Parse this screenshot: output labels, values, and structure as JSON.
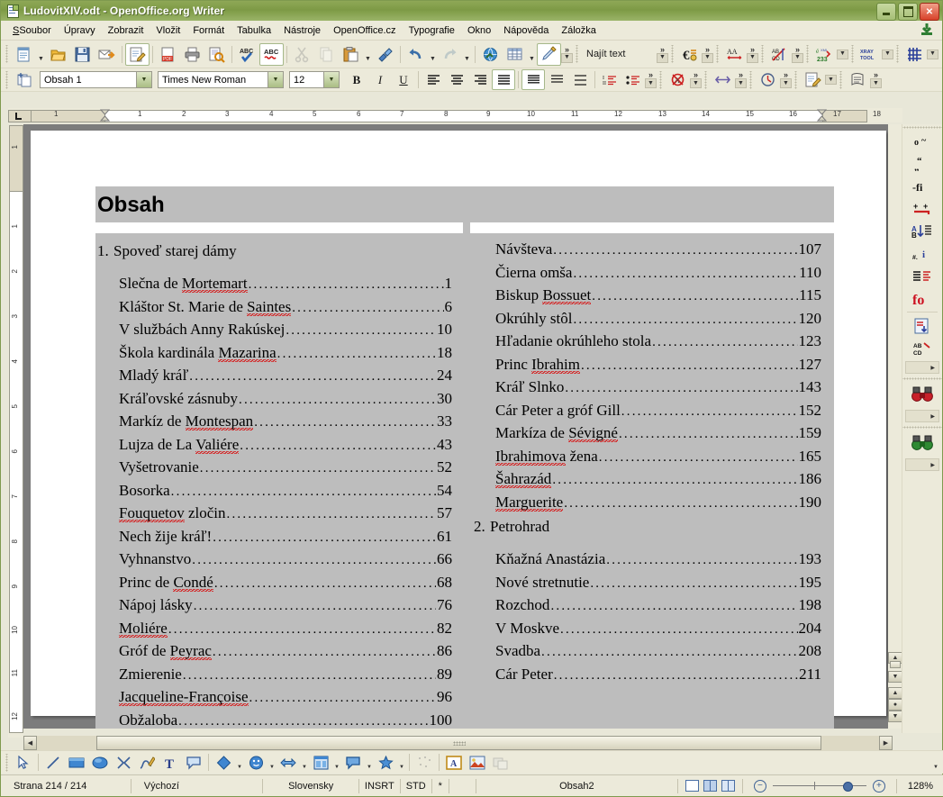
{
  "window": {
    "title": "LudovitXIV.odt - OpenOffice.org Writer",
    "minimize_label": "Minimize",
    "maximize_label": "Maximize",
    "close_label": "Close"
  },
  "menubar": {
    "items": [
      {
        "label": "Soubor",
        "mnemonic_index": 0
      },
      {
        "label": "Úpravy",
        "mnemonic_index": 0
      },
      {
        "label": "Zobrazit",
        "mnemonic_index": 0
      },
      {
        "label": "Vložit",
        "mnemonic_index": 1
      },
      {
        "label": "Formát",
        "mnemonic_index": 0
      },
      {
        "label": "Tabulka",
        "mnemonic_index": 0
      },
      {
        "label": "Nástroje",
        "mnemonic_index": 0
      },
      {
        "label": "OpenOffice.cz",
        "mnemonic_index": -1
      },
      {
        "label": "Typografie",
        "mnemonic_index": -1
      },
      {
        "label": "Okno",
        "mnemonic_index": 0
      },
      {
        "label": "Nápověda",
        "mnemonic_index": 4
      },
      {
        "label": "Záložka",
        "mnemonic_index": 0
      }
    ]
  },
  "standard_toolbar": {
    "items": [
      {
        "name": "new-document-icon",
        "label": "Nový"
      },
      {
        "name": "new-document-dropdown",
        "label": "Nový - rozbalit"
      },
      {
        "name": "open-folder-icon",
        "label": "Otevřít"
      },
      {
        "name": "save-icon",
        "label": "Uložit"
      },
      {
        "name": "email-document-icon",
        "label": "Odeslat e-mailem"
      },
      {
        "name": "edit-file-icon",
        "label": "Režim úprav"
      },
      {
        "name": "export-pdf-icon",
        "label": "Exportovat do PDF"
      },
      {
        "name": "print-icon",
        "label": "Tisk"
      },
      {
        "name": "print-preview-icon",
        "label": "Náhled"
      },
      {
        "name": "spellcheck-icon",
        "label": "Kontrola pravopisu"
      },
      {
        "name": "autospellcheck-icon",
        "label": "Automatická kontrola pravopisu"
      },
      {
        "name": "cut-icon",
        "label": "Vyjmout"
      },
      {
        "name": "copy-icon",
        "label": "Kopírovat"
      },
      {
        "name": "paste-icon",
        "label": "Vložit"
      },
      {
        "name": "paste-dropdown",
        "label": "Vložit - rozbalit"
      },
      {
        "name": "format-paintbrush-icon",
        "label": "Štětec formátu"
      },
      {
        "name": "undo-icon",
        "label": "Zpět"
      },
      {
        "name": "undo-dropdown",
        "label": "Zpět - rozbalit"
      },
      {
        "name": "redo-icon",
        "label": "Znovu"
      },
      {
        "name": "redo-dropdown",
        "label": "Znovu - rozbalit"
      },
      {
        "name": "hyperlink-icon",
        "label": "Hypertextový odkaz"
      },
      {
        "name": "insert-table-icon",
        "label": "Tabulka"
      },
      {
        "name": "insert-table-dropdown",
        "label": "Tabulka - rozbalit"
      },
      {
        "name": "edit-highlight-icon",
        "label": "Revize"
      }
    ]
  },
  "find_toolbar": {
    "placeholder": "Najít text",
    "value": ""
  },
  "extra_toolbars": [
    {
      "name": "euro-converter-icon",
      "label": "Převodník měn"
    },
    {
      "name": "change-case-icon",
      "label": "Velikost písmen"
    },
    {
      "name": "abc-cd-strike-icon",
      "label": "Typografie"
    },
    {
      "name": "xml-e233-icon",
      "label": "XML nástroje"
    },
    {
      "name": "xray-tool-icon",
      "label": "XRAY TOOL"
    },
    {
      "name": "grid-macro-icon",
      "label": "Makro mřížka"
    }
  ],
  "formatting_toolbar": {
    "paragraph_style": {
      "value": "Obsah 1",
      "name": "paragraph-style-combo"
    },
    "font_name": {
      "value": "Times New Roman",
      "name": "font-name-combo"
    },
    "font_size": {
      "value": "12",
      "name": "font-size-combo"
    },
    "buttons": [
      {
        "name": "bold-button",
        "glyph": "B",
        "active": false
      },
      {
        "name": "italic-button",
        "glyph": "I",
        "active": false
      },
      {
        "name": "underline-button",
        "glyph": "U",
        "active": false
      },
      {
        "name": "align-left-button",
        "active": false
      },
      {
        "name": "align-center-button",
        "active": false
      },
      {
        "name": "align-right-button",
        "active": false
      },
      {
        "name": "align-justify-button",
        "active": true
      },
      {
        "name": "line-spacing-single-button",
        "active": true
      },
      {
        "name": "line-spacing-1_5-button",
        "active": false
      },
      {
        "name": "line-spacing-double-button",
        "active": false
      },
      {
        "name": "numbered-list-button",
        "active": false
      },
      {
        "name": "bulleted-list-button",
        "active": false
      },
      {
        "name": "no-character-formatting-icon",
        "active": false
      },
      {
        "name": "horizontal-resize-icon",
        "active": false
      },
      {
        "name": "clock-tool-icon",
        "active": false
      },
      {
        "name": "note-edit-icon",
        "active": false
      },
      {
        "name": "page-style-icon",
        "active": false
      }
    ]
  },
  "ruler": {
    "horizontal_ticks": [
      "1",
      "2",
      "3",
      "4",
      "5",
      "6",
      "7",
      "8",
      "9",
      "10",
      "11",
      "12",
      "13",
      "14",
      "15",
      "16",
      "17",
      "18"
    ],
    "indent_ticks": [
      "1"
    ],
    "vertical_ticks": [
      "1",
      "2",
      "3",
      "4",
      "5",
      "6",
      "7",
      "8",
      "9",
      "10",
      "11",
      "12"
    ],
    "vertical_margin_tick": "1"
  },
  "document": {
    "toc_heading": "Obsah",
    "chapters": [
      {
        "column": "left",
        "number": "1.",
        "title": "Spoveď starej dámy",
        "entries": [
          {
            "title": "Slečna de Mortemart",
            "page": "1",
            "misspelled": "Mortemart"
          },
          {
            "title": "Kláštor St. Marie de Saintes",
            "page": "6",
            "misspelled": "Saintes"
          },
          {
            "title": "V službách Anny Rakúskej",
            "page": "10",
            "misspelled": ""
          },
          {
            "title": "Škola kardinála Mazarina",
            "page": "18",
            "misspelled": "Mazarina"
          },
          {
            "title": "Mladý kráľ",
            "page": "24",
            "misspelled": ""
          },
          {
            "title": "Kráľovské zásnuby",
            "page": "30",
            "misspelled": ""
          },
          {
            "title": "Markíz de Montespan",
            "page": "33",
            "misspelled": "Montespan"
          },
          {
            "title": "Lujza de La Valiére",
            "page": "43",
            "misspelled": "Valiére"
          },
          {
            "title": "Vyšetrovanie",
            "page": "52",
            "misspelled": ""
          },
          {
            "title": "Bosorka",
            "page": "54",
            "misspelled": ""
          },
          {
            "title": "Fouquetov zločin",
            "page": "57",
            "misspelled": "Fouquetov"
          },
          {
            "title": "Nech žije kráľ!",
            "page": "61",
            "misspelled": ""
          },
          {
            "title": "Vyhnanstvo",
            "page": "66",
            "misspelled": ""
          },
          {
            "title": "Princ de Condé",
            "page": "68",
            "misspelled": "Condé"
          },
          {
            "title": "Nápoj lásky",
            "page": "76",
            "misspelled": ""
          },
          {
            "title": "Moliére",
            "page": "82",
            "misspelled": "Moliére"
          },
          {
            "title": "Gróf de Peyrac",
            "page": "86",
            "misspelled": "Peyrac"
          },
          {
            "title": "Zmierenie",
            "page": "89",
            "misspelled": ""
          },
          {
            "title": "Jacqueline-Françoise",
            "page": "96",
            "misspelled": "Jacqueline-Françoise"
          },
          {
            "title": "Obžaloba",
            "page": "100",
            "misspelled": ""
          }
        ]
      },
      {
        "column": "right",
        "number": "",
        "title": "",
        "entries": [
          {
            "title": "Návšteva",
            "page": "107",
            "misspelled": ""
          },
          {
            "title": "Čierna omša",
            "page": "110",
            "misspelled": ""
          },
          {
            "title": "Biskup Bossuet",
            "page": "115",
            "misspelled": "Bossuet"
          },
          {
            "title": "Okrúhly stôl",
            "page": "120",
            "misspelled": ""
          },
          {
            "title": "Hľadanie okrúhleho stola",
            "page": "123",
            "misspelled": ""
          },
          {
            "title": "Princ Ibrahim",
            "page": "127",
            "misspelled": "Ibrahim"
          },
          {
            "title": "Kráľ Slnko",
            "page": "143",
            "misspelled": ""
          },
          {
            "title": "Cár Peter a gróf Gill",
            "page": "152",
            "misspelled": ""
          },
          {
            "title": "Markíza de Sévigné",
            "page": "159",
            "misspelled": "Sévigné"
          },
          {
            "title": "Ibrahimova žena",
            "page": "165",
            "misspelled": "Ibrahimova"
          },
          {
            "title": "Šahrazád",
            "page": "186",
            "misspelled": "Šahrazád"
          },
          {
            "title": "Marguerite",
            "page": "190",
            "misspelled": "Marguerite"
          }
        ]
      },
      {
        "column": "right",
        "number": "2.",
        "title": "Petrohrad",
        "entries": [
          {
            "title": "Kňažná Anastázia",
            "page": "193",
            "misspelled": ""
          },
          {
            "title": "Nové stretnutie",
            "page": "195",
            "misspelled": ""
          },
          {
            "title": "Rozchod",
            "page": "198",
            "misspelled": ""
          },
          {
            "title": "V Moskve",
            "page": "204",
            "misspelled": ""
          },
          {
            "title": "Svadba",
            "page": "208",
            "misspelled": ""
          },
          {
            "title": "Cár Peter",
            "page": "211",
            "misspelled": ""
          }
        ]
      }
    ]
  },
  "sidebar_toolbar": {
    "items": [
      {
        "name": "degree-symbol-icon",
        "label": "o~"
      },
      {
        "name": "quotes-icon",
        "label": "“„"
      },
      {
        "name": "ligature-fi-icon",
        "label": "-fi"
      },
      {
        "name": "nonbreaking-space-icon",
        "label": "␣"
      },
      {
        "name": "sort-ab-icon",
        "label": "A↓B"
      },
      {
        "name": "number-info-icon",
        "label": "#.i"
      },
      {
        "name": "paragraph-marks-icon",
        "label": "¶"
      },
      {
        "name": "fo-red-icon",
        "label": "fo"
      },
      {
        "name": "insert-page-icon",
        "label": "page"
      },
      {
        "name": "ab-cd-icon",
        "label": "AB CD"
      }
    ],
    "binoculars_red": {
      "name": "find-red-binoculars-icon",
      "label": "Hledat"
    },
    "binoculars_green": {
      "name": "find-green-binoculars-icon",
      "label": "Hledat 2"
    }
  },
  "drawing_toolbar": {
    "items": [
      {
        "name": "select-arrow-icon",
        "label": "Výběr"
      },
      {
        "name": "line-icon",
        "label": "Čára"
      },
      {
        "name": "rectangle-icon",
        "label": "Obdélník"
      },
      {
        "name": "ellipse-icon",
        "label": "Elipsa"
      },
      {
        "name": "polygon-icon",
        "label": "Mnohoúhelník"
      },
      {
        "name": "freeform-line-icon",
        "label": "Od ruky"
      },
      {
        "name": "text-box-icon",
        "label": "Textové pole"
      },
      {
        "name": "callout-icon",
        "label": "Bublina"
      },
      {
        "name": "basic-shapes-icon",
        "label": "Základní tvary"
      },
      {
        "name": "symbol-shapes-icon",
        "label": "Symboly"
      },
      {
        "name": "block-arrows-icon",
        "label": "Blokové šipky"
      },
      {
        "name": "flowchart-icon",
        "label": "Vývojové diagramy"
      },
      {
        "name": "callout-shapes-icon",
        "label": "Bubliny"
      },
      {
        "name": "stars-icon",
        "label": "Hvězdy"
      },
      {
        "name": "points-icon",
        "label": "Body"
      },
      {
        "name": "fontwork-icon",
        "label": "Písmomalba"
      },
      {
        "name": "insert-image-icon",
        "label": "Obrázek"
      },
      {
        "name": "to-background-icon",
        "label": "Na pozadí"
      }
    ]
  },
  "statusbar": {
    "page": "Strana 214 / 214",
    "page_style": "Výchozí",
    "language": "Slovensky",
    "insert_mode": "INSRT",
    "selection_mode": "STD",
    "modified": "*",
    "section": "Obsah2",
    "view_single_label": "Jedna stránka",
    "view_double_label": "Dvě stránky",
    "view_book_label": "Kniha",
    "zoom_out_label": "Zmenšit",
    "zoom_in_label": "Zvětšit",
    "zoom": "128%"
  },
  "colors": {
    "titlebar": "#7d9a45",
    "chrome": "#eceada",
    "toc_background": "#bdbdbd",
    "desktop": "#7c7c7c",
    "spellcheck_underline": "#d81010"
  }
}
